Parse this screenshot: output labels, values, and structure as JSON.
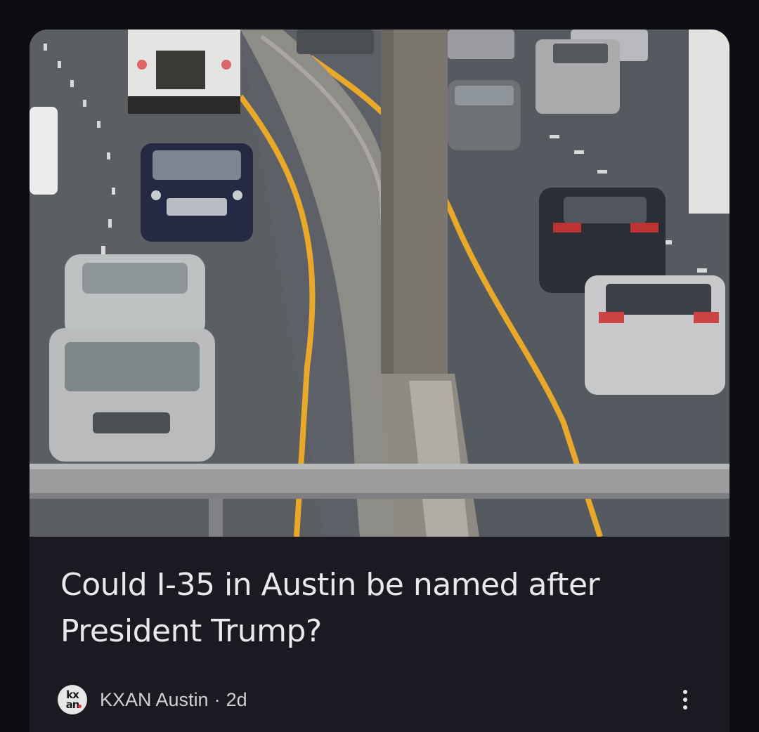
{
  "article": {
    "headline": "Could I-35 in Austin be named after President Trump?",
    "image_description": "",
    "source": {
      "name": "KXAN Austin",
      "logo_text_line1": "kx",
      "logo_text_line2": "an",
      "separator": "·",
      "age": "2d"
    },
    "more_icon": "more-vertical-icon"
  },
  "colors": {
    "background": "#0e0d14",
    "card": "#1b1a22",
    "headline_text": "#e9e8ee",
    "meta_text": "#cfcfd6"
  }
}
